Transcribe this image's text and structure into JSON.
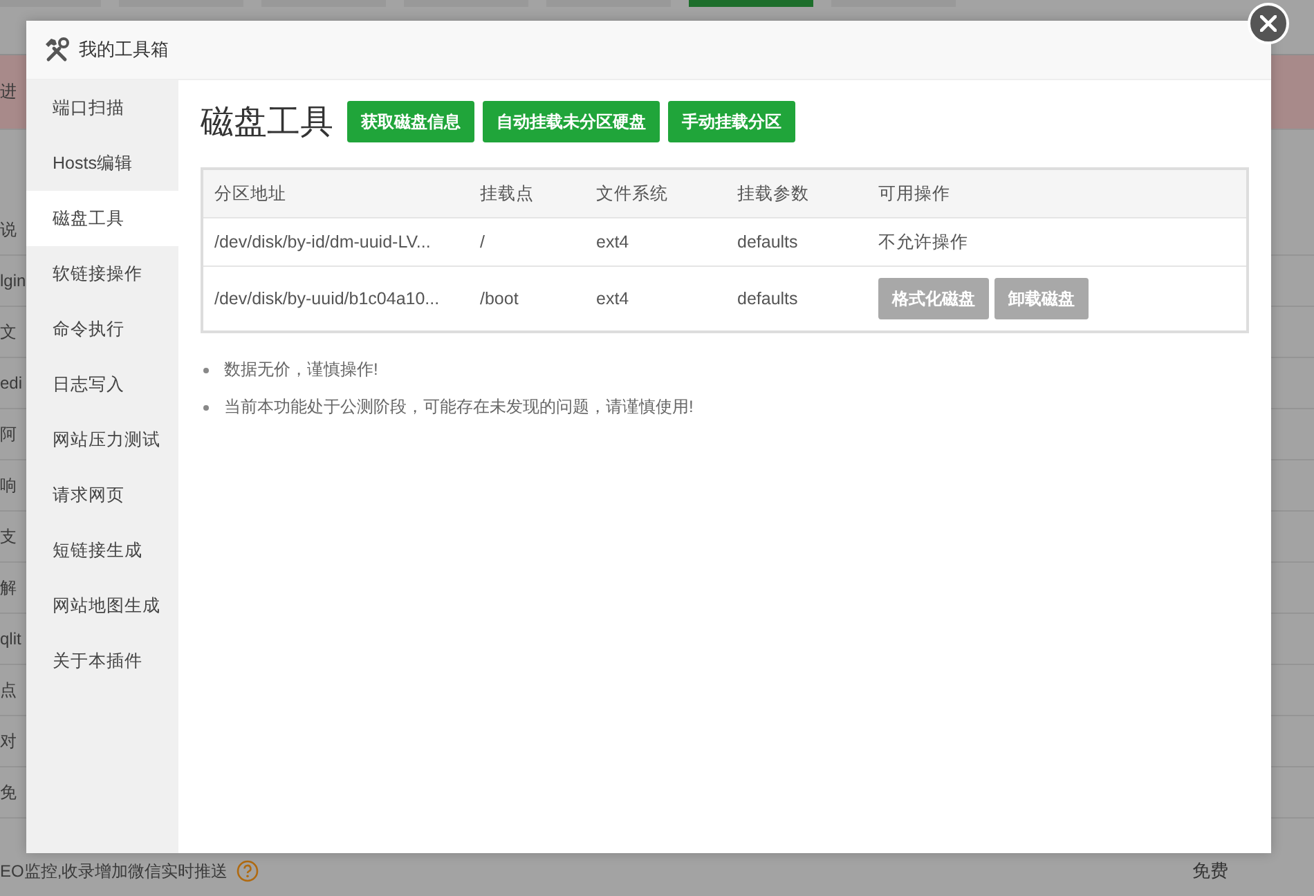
{
  "background_page": {
    "top_tabs": [
      {
        "selected": false
      },
      {
        "selected": false
      },
      {
        "selected": false
      },
      {
        "selected": false
      },
      {
        "selected": false
      },
      {
        "selected": true
      },
      {
        "selected": false
      }
    ],
    "rows": [
      {
        "text": "进",
        "highlighted": true
      },
      {
        "text": "说",
        "highlighted": false
      },
      {
        "text": "lgin",
        "highlighted": false
      },
      {
        "text": "文",
        "highlighted": false
      },
      {
        "text": "edi",
        "highlighted": false
      },
      {
        "text": "阿",
        "highlighted": false
      },
      {
        "text": "响",
        "highlighted": false
      },
      {
        "text": "支",
        "highlighted": false
      },
      {
        "text": "解",
        "highlighted": false
      },
      {
        "text": "qlit",
        "highlighted": false
      },
      {
        "text": "点",
        "highlighted": false
      },
      {
        "text": "对",
        "highlighted": false
      },
      {
        "text": "免",
        "highlighted": false
      }
    ],
    "last_row": {
      "text": "EO监控,收录增加微信实时推送",
      "price": "免费"
    }
  },
  "dialog": {
    "title": "我的工具箱",
    "sidebar": {
      "items": [
        {
          "label": "端口扫描",
          "selected": false
        },
        {
          "label": "Hosts编辑",
          "selected": false
        },
        {
          "label": "磁盘工具",
          "selected": true
        },
        {
          "label": "软链接操作",
          "selected": false
        },
        {
          "label": "命令执行",
          "selected": false
        },
        {
          "label": "日志写入",
          "selected": false
        },
        {
          "label": "网站压力测试",
          "selected": false
        },
        {
          "label": "请求网页",
          "selected": false
        },
        {
          "label": "短链接生成",
          "selected": false
        },
        {
          "label": "网站地图生成",
          "selected": false
        },
        {
          "label": "关于本插件",
          "selected": false
        }
      ]
    },
    "heading": "磁盘工具",
    "toolbar": [
      "获取磁盘信息",
      "自动挂载未分区硬盘",
      "手动挂载分区"
    ],
    "table": {
      "columns": [
        "分区地址",
        "挂载点",
        "文件系统",
        "挂载参数",
        "可用操作"
      ],
      "rows": [
        {
          "cells": [
            "/dev/disk/by-id/dm-uuid-LV...",
            "/",
            "ext4",
            "defaults"
          ],
          "action": {
            "kind": "text",
            "text": "不允许操作"
          }
        },
        {
          "cells": [
            "/dev/disk/by-uuid/b1c04a10...",
            "/boot",
            "ext4",
            "defaults"
          ],
          "action": {
            "kind": "buttons",
            "buttons": [
              {
                "label": "格式化磁盘",
                "disabled": true
              },
              {
                "label": "卸载磁盘",
                "disabled": true
              }
            ]
          }
        }
      ]
    },
    "notes": [
      "数据无价，谨慎操作!",
      "当前本功能处于公测阶段，可能存在未发现的问题，请谨慎使用!"
    ]
  }
}
